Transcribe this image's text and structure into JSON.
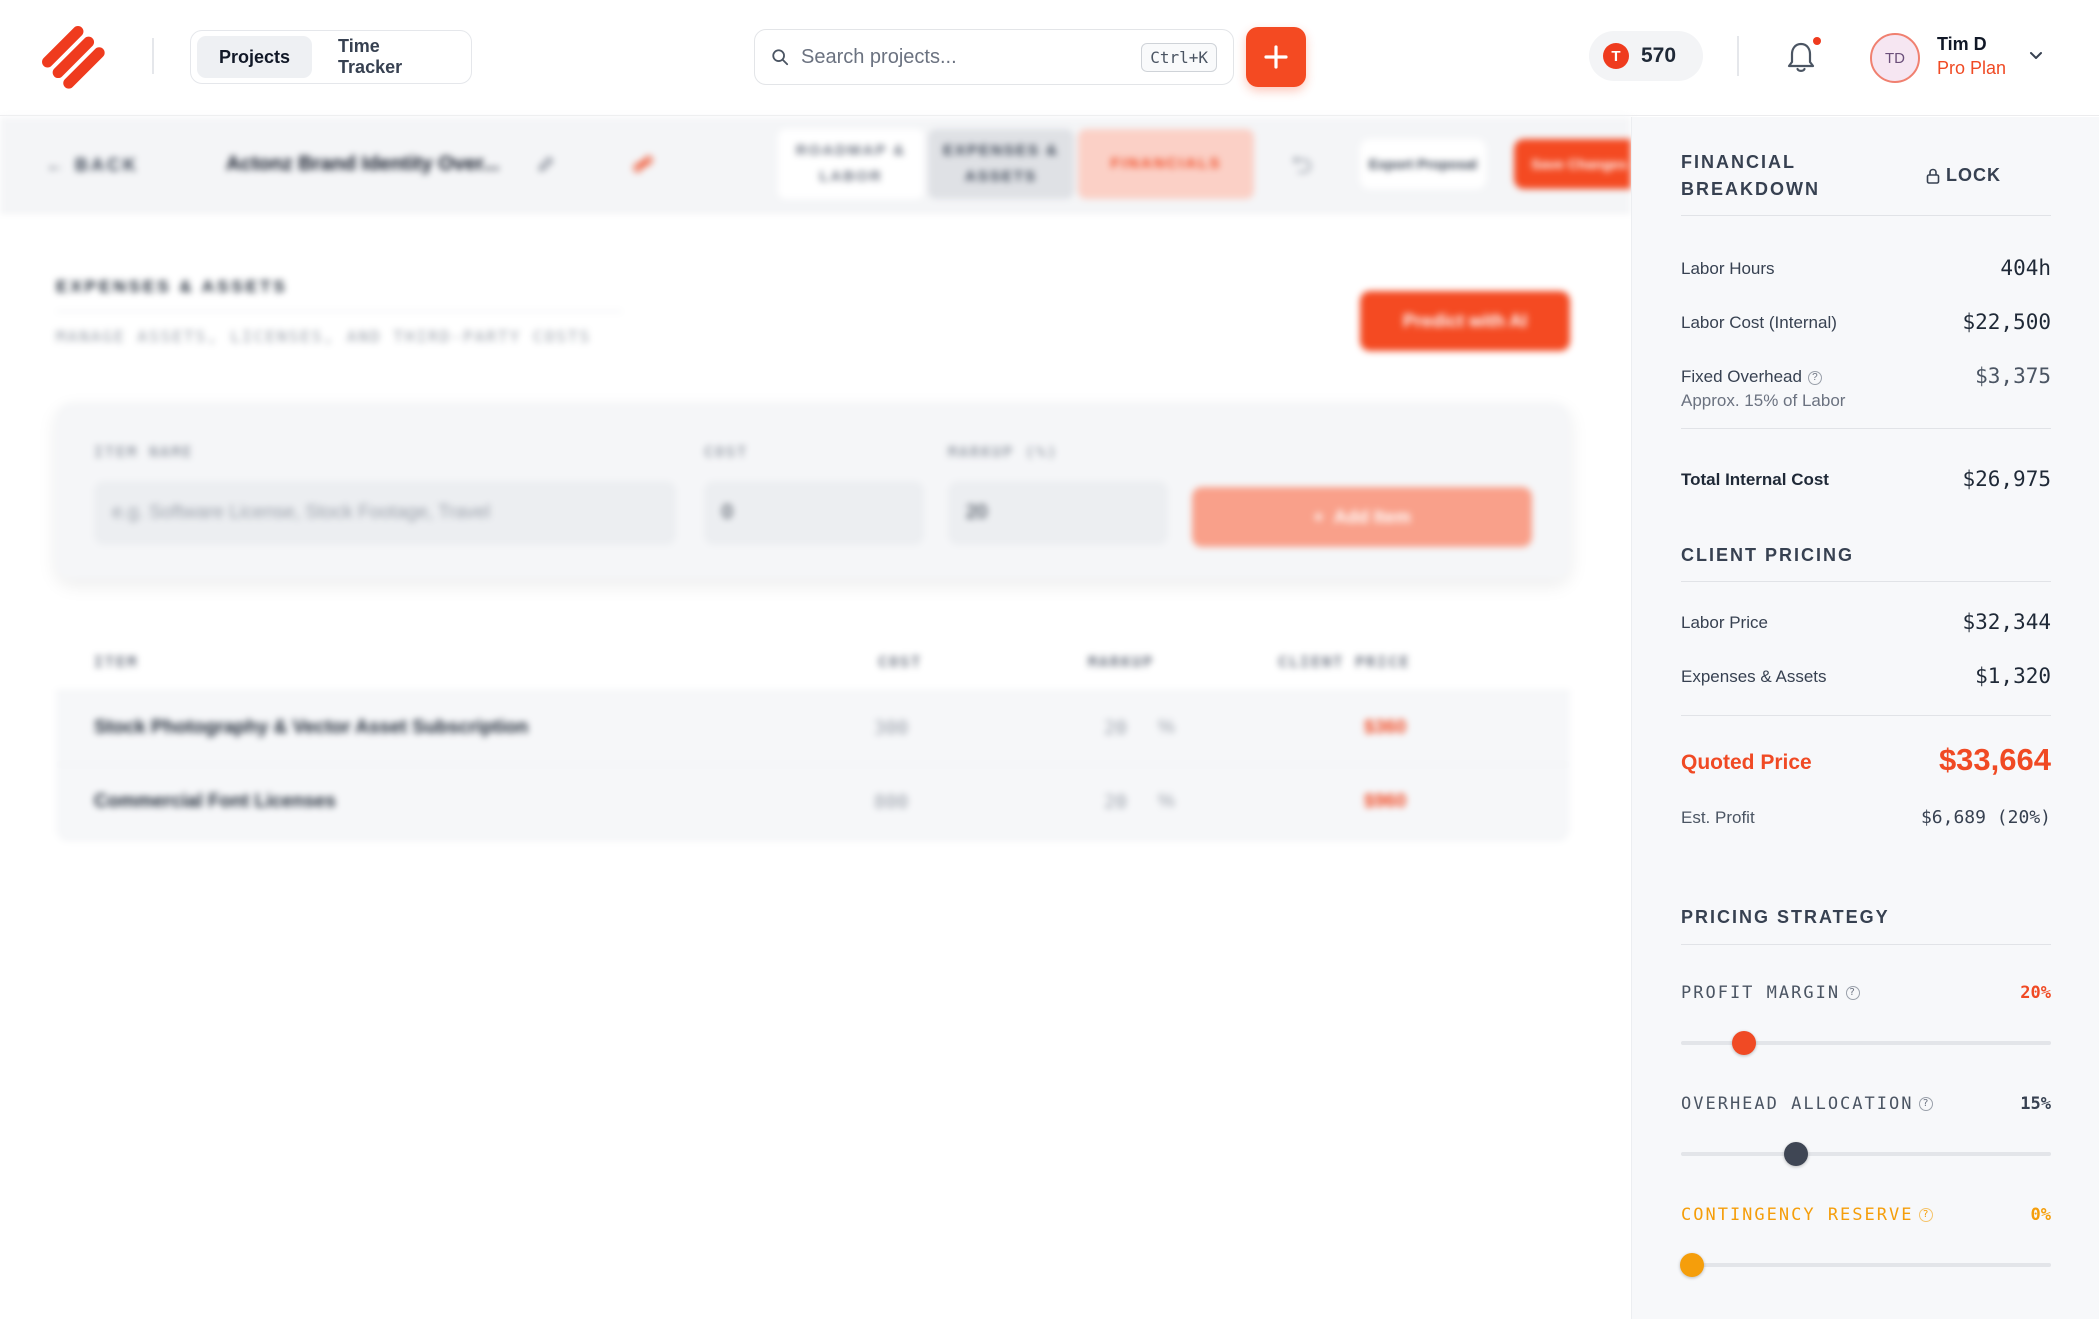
{
  "header": {
    "tabs": [
      {
        "label": "Projects",
        "active": true
      },
      {
        "label": "Time Tracker",
        "active": false
      }
    ],
    "search_placeholder": "Search projects...",
    "search_shortcut": "Ctrl+K",
    "token_icon_letter": "T",
    "token_count": "570",
    "user": {
      "initials": "TD",
      "name": "Tim D",
      "plan": "Pro Plan"
    }
  },
  "subbar": {
    "back_label": "BACK",
    "project_title": "Actonz Brand Identity Over...",
    "tabs": [
      "ROADMAP & LABOR",
      "EXPENSES & ASSETS",
      "FINANCIALS"
    ],
    "export_label": "Export Proposal",
    "save_label": "Save Changes"
  },
  "expenses": {
    "title": "EXPENSES & ASSETS",
    "subtitle": "MANAGE ASSETS, LICENSES, AND THIRD-PARTY COSTS",
    "predict_label": "Predict with AI",
    "form": {
      "item_label": "ITEM NAME",
      "item_placeholder": "e.g. Software License, Stock Footage, Travel",
      "cost_label": "COST",
      "cost_value": "0",
      "markup_label": "MARKUP (%)",
      "markup_value": "20",
      "add_label": "Add Item"
    },
    "table": {
      "columns": [
        "ITEM",
        "COST",
        "MARKUP",
        "CLIENT PRICE"
      ],
      "rows": [
        {
          "item": "Stock Photography & Vector Asset Subscription",
          "cost": "300",
          "markup": "20",
          "pct": "%",
          "price": "$360"
        },
        {
          "item": "Commercial Font Licenses",
          "cost": "800",
          "markup": "20",
          "pct": "%",
          "price": "$960"
        }
      ]
    }
  },
  "financial": {
    "title": "FINANCIAL BREAKDOWN",
    "lock_label": "LOCK",
    "labor_hours_label": "Labor Hours",
    "labor_hours": "404h",
    "labor_cost_label": "Labor Cost (Internal)",
    "labor_cost": "$22,500",
    "overhead_label": "Fixed Overhead",
    "overhead_note": "Approx. 15% of Labor",
    "overhead": "$3,375",
    "total_label": "Total Internal Cost",
    "total": "$26,975"
  },
  "client_pricing": {
    "title": "CLIENT PRICING",
    "labor_price_label": "Labor Price",
    "labor_price": "$32,344",
    "expenses_label": "Expenses & Assets",
    "expenses": "$1,320",
    "quoted_label": "Quoted Price",
    "quoted": "$33,664",
    "profit_label": "Est. Profit",
    "profit": "$6,689 (20%)"
  },
  "pricing_strategy": {
    "title": "PRICING STRATEGY",
    "sliders": [
      {
        "label": "PROFIT MARGIN",
        "value_text": "20%",
        "level": 0.17,
        "color": "#f04a24"
      },
      {
        "label": "OVERHEAD ALLOCATION",
        "value_text": "15%",
        "level": 0.31,
        "color": "#3f4654"
      },
      {
        "label": "CONTINGENCY RESERVE",
        "value_text": "0%",
        "level": 0.03,
        "color": "#f59e0b"
      }
    ]
  },
  "colors": {
    "accent": "#f44a22",
    "contingency": "#f59e0b"
  }
}
